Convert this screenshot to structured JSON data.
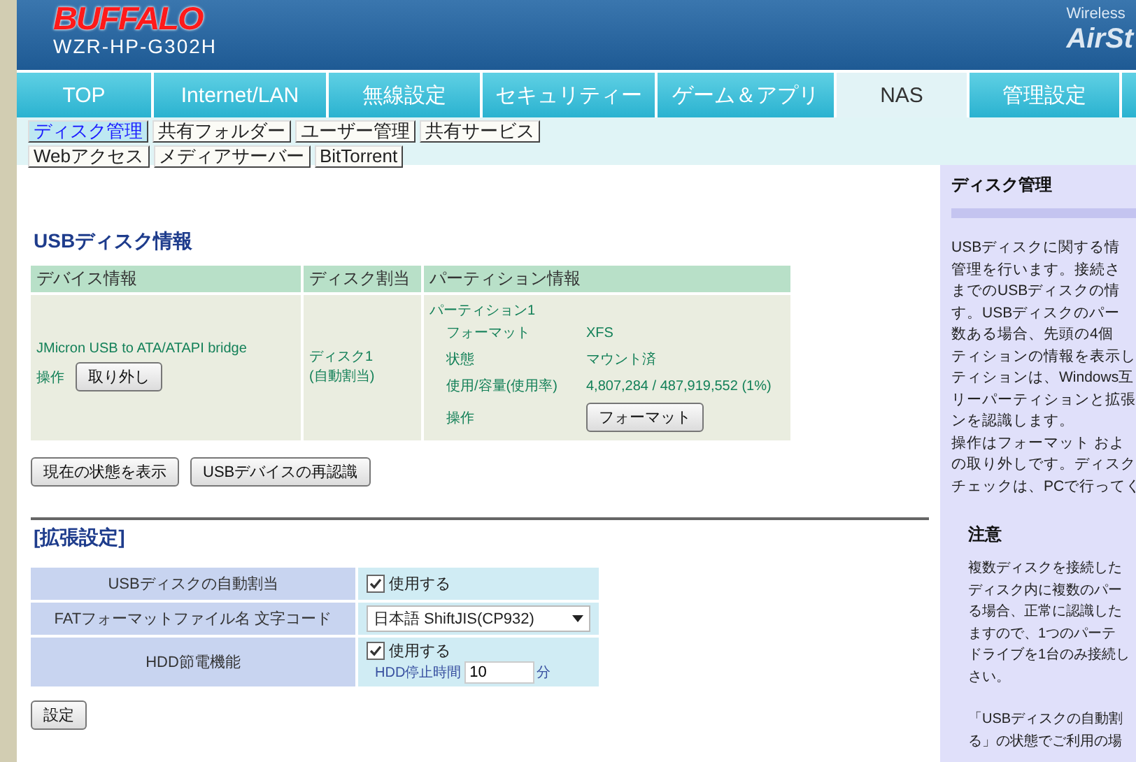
{
  "header": {
    "logo": "BUFFALO",
    "model": "WZR-HP-G302H",
    "brand_small": "Wireless",
    "brand_large": "AirSt"
  },
  "tabs": [
    {
      "label": "TOP",
      "selected": false
    },
    {
      "label": "Internet/LAN",
      "selected": false
    },
    {
      "label": "無線設定",
      "selected": false
    },
    {
      "label": "セキュリティー",
      "selected": false
    },
    {
      "label": "ゲーム＆アプリ",
      "selected": false
    },
    {
      "label": "NAS",
      "selected": true
    },
    {
      "label": "管理設定",
      "selected": false
    }
  ],
  "subtabs": [
    [
      {
        "label": "ディスク管理",
        "selected": true
      },
      {
        "label": "共有フォルダー",
        "selected": false
      },
      {
        "label": "ユーザー管理",
        "selected": false
      },
      {
        "label": "共有サービス",
        "selected": false
      }
    ],
    [
      {
        "label": "Webアクセス",
        "selected": false
      },
      {
        "label": "メディアサーバー",
        "selected": false
      },
      {
        "label": "BitTorrent",
        "selected": false
      }
    ]
  ],
  "usb_disk_info": {
    "title": "USBディスク情報",
    "columns": [
      "デバイス情報",
      "ディスク割当",
      "パーティション情報"
    ],
    "device": {
      "name": "JMicron USB to ATA/ATAPI bridge",
      "action_label": "操作",
      "button": "取り外し"
    },
    "disk": {
      "name": "ディスク1",
      "note": "(自動割当)"
    },
    "partition": {
      "name": "パーティション1",
      "fields": [
        {
          "label": "フォーマット",
          "value": "XFS"
        },
        {
          "label": "状態",
          "value": "マウント済"
        },
        {
          "label": "使用/容量(使用率)",
          "value": "4,807,284 / 487,919,552 (1%)"
        }
      ],
      "action_label": "操作",
      "button": "フォーマット"
    }
  },
  "buttons": [
    "現在の状態を表示",
    "USBデバイスの再認識"
  ],
  "extended": {
    "title": "[拡張設定]",
    "rows": [
      {
        "kind": "checkbox",
        "label": "USBディスクの自動割当",
        "option_label": "使用する",
        "checked": true
      },
      {
        "kind": "select",
        "label": "FATフォーマットファイル名 文字コード",
        "value": "日本語 ShiftJIS(CP932)"
      },
      {
        "kind": "checkbox_time",
        "label": "HDD節電機能",
        "option_label": "使用する",
        "checked": true,
        "time_label": "HDD停止時間",
        "time_value": "10",
        "unit": "分"
      }
    ],
    "submit": "設定"
  },
  "help": {
    "title": "ディスク管理",
    "lines": [
      "USBディスクに関する情",
      "管理を行います。接続さ",
      "までのUSBディスクの情",
      "す。USBディスクのパー",
      "数ある場合、先頭の4個",
      "ティションの情報を表示し",
      "ティションは、Windows互",
      "リーパーティションと拡張",
      "ンを認識します。",
      "操作はフォーマット およ",
      "の取り外しです。ディスク",
      "チェックは、PCで行ってく"
    ],
    "note_title": "注意",
    "note_paragraphs": [
      [
        "複数ディスクを接続した",
        "ディスク内に複数のパー",
        "る場合、正常に認識した",
        "ますので、1つのパーテ",
        "ドライブを1台のみ接続し",
        "さい。"
      ],
      [
        "「USBディスクの自動割",
        "る」の状態でご利用の場"
      ]
    ]
  }
}
